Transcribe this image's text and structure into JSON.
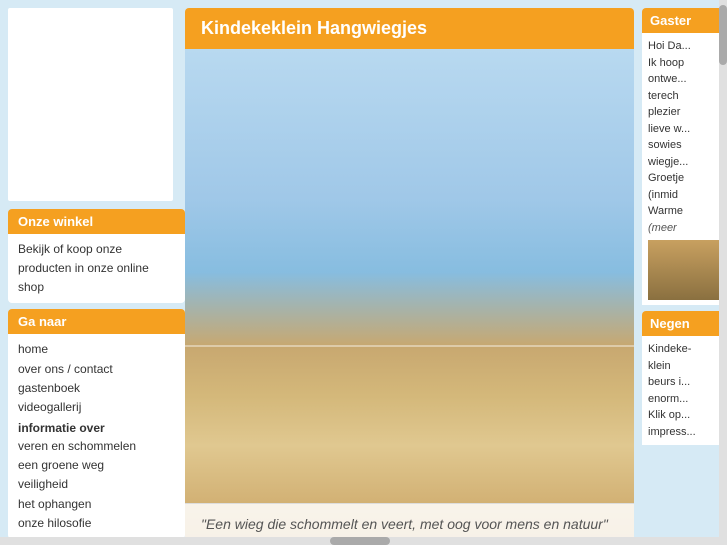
{
  "header": {
    "title": "Kindekeklein Hangwiegjes"
  },
  "sidebar": {
    "shop_box": {
      "title": "Onze winkel",
      "description": "Bekijk of koop onze producten in onze online shop"
    },
    "nav_box": {
      "title": "Ga naar",
      "links": [
        {
          "label": "home",
          "href": "#"
        },
        {
          "label": "over ons / contact",
          "href": "#"
        },
        {
          "label": "gastenboek",
          "href": "#"
        },
        {
          "label": "videogallerij",
          "href": "#"
        }
      ],
      "info_section_title": "informatie over",
      "info_links": [
        {
          "label": "veren en schommelen",
          "href": "#"
        },
        {
          "label": "een groene weg",
          "href": "#"
        },
        {
          "label": "veiligheid",
          "href": "#"
        },
        {
          "label": "het ophangen",
          "href": "#"
        },
        {
          "label": "onze hilosofie",
          "href": "#"
        }
      ]
    }
  },
  "right_sidebar": {
    "guestbook_box": {
      "title": "Gaster",
      "content": "Hoi Da... Ik hoop ontwe... terech plezier lieve w... sowies wiegje...",
      "greeting": "Groetje (inmid Warme (meer"
    },
    "nieuws_box": {
      "title": "Negen",
      "content": "Kindekeklein beurs i... enorm... Klik op... impress..."
    }
  },
  "quote": {
    "text": "\"Een wieg die schommelt en veert, met oog voor mens en natuur\""
  }
}
